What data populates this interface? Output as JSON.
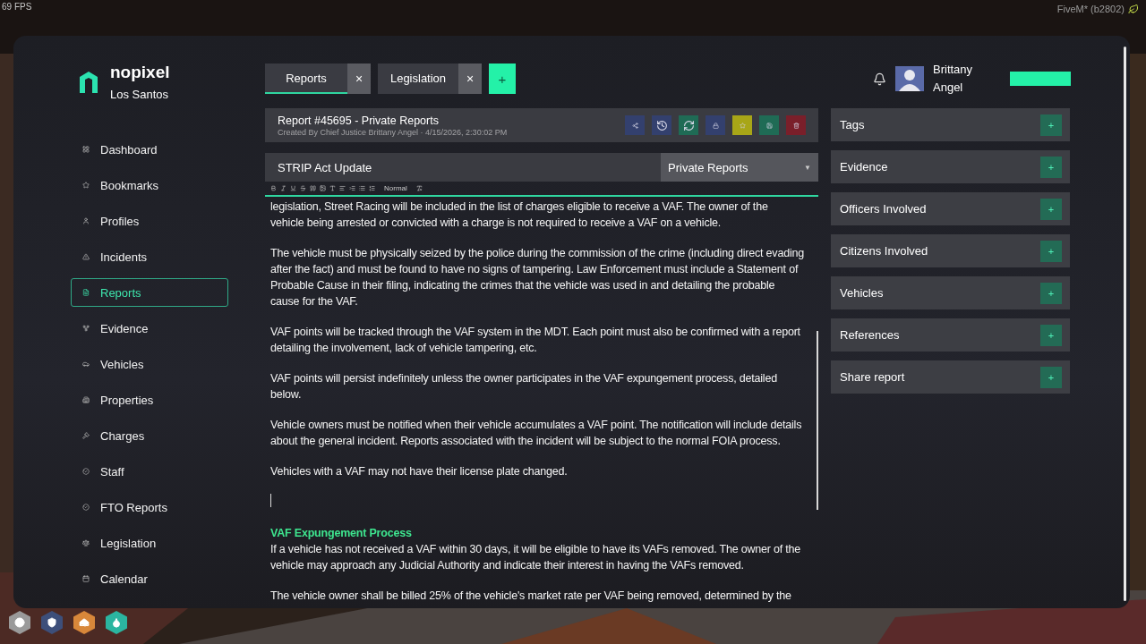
{
  "overlay": {
    "fps": "69 FPS",
    "build": "FiveM* (b2802)"
  },
  "brand": {
    "name": "nopixel",
    "city": "Los Santos"
  },
  "sidebar": {
    "items": [
      {
        "label": "Dashboard",
        "kind": "grid",
        "selected": false
      },
      {
        "label": "Bookmarks",
        "kind": "star",
        "selected": false
      },
      {
        "label": "Profiles",
        "kind": "user",
        "selected": false
      },
      {
        "label": "Incidents",
        "kind": "alert",
        "selected": false
      },
      {
        "label": "Reports",
        "kind": "file",
        "selected": true
      },
      {
        "label": "Evidence",
        "kind": "fork",
        "selected": false
      },
      {
        "label": "Vehicles",
        "kind": "car",
        "selected": false
      },
      {
        "label": "Properties",
        "kind": "building",
        "selected": false
      },
      {
        "label": "Charges",
        "kind": "gavel",
        "selected": false
      },
      {
        "label": "Staff",
        "kind": "badge",
        "selected": false
      },
      {
        "label": "FTO Reports",
        "kind": "badge",
        "selected": false
      },
      {
        "label": "Legislation",
        "kind": "scale",
        "selected": false
      },
      {
        "label": "Calendar",
        "kind": "calendar",
        "selected": false
      }
    ]
  },
  "tabs": [
    {
      "label": "Reports",
      "close": "×",
      "selected": true
    },
    {
      "label": "Legislation",
      "close": "×",
      "selected": false
    }
  ],
  "new_tab": "+",
  "user": {
    "name": "Brittany Angel"
  },
  "report": {
    "title": "Report #45695 - Private Reports",
    "subtitle": "Created By Chief Justice Brittany Angel · 4/15/2026, 2:30:02 PM",
    "actions": [
      {
        "kind": "share",
        "color": "#33406e"
      },
      {
        "kind": "history",
        "color": "#33406e"
      },
      {
        "kind": "refresh",
        "color": "#1f6b55"
      },
      {
        "kind": "lock",
        "color": "#33406e"
      },
      {
        "kind": "star",
        "color": "#a8a617"
      },
      {
        "kind": "save",
        "color": "#1f6b55"
      },
      {
        "kind": "delete",
        "color": "#7a1f2a"
      }
    ],
    "name": "STRIP Act Update",
    "category": "Private Reports",
    "caret": "▼"
  },
  "editor": {
    "heading_style": "Normal",
    "content": [
      {
        "kind": "paragraph",
        "text": "legislation, Street Racing will be included in the list of charges eligible to receive a VAF. The owner of the vehicle being arrested or convicted with a charge is not required to receive a VAF on a vehicle."
      },
      {
        "kind": "paragraph",
        "text": "The vehicle must be physically seized by the police during the commission of the crime (including direct evading after the fact) and must be found to have no signs of tampering. Law Enforcement must include a Statement of Probable Cause in their filing, indicating the crimes that the vehicle was used in and detailing the probable cause for the VAF."
      },
      {
        "kind": "paragraph",
        "text": "VAF points will be tracked through the VAF system in the MDT. Each point must also be confirmed with a report detailing the involvement, lack of vehicle tampering, etc."
      },
      {
        "kind": "paragraph",
        "text": "VAF points will persist indefinitely unless the owner participates in the VAF expungement process, detailed below."
      },
      {
        "kind": "paragraph",
        "text": "Vehicle owners must be notified when their vehicle accumulates a VAF point. The notification will include details about the general incident. Reports associated with the incident will be subject to the normal FOIA process."
      },
      {
        "kind": "paragraph",
        "text": "Vehicles with a VAF may not have their license plate changed."
      },
      {
        "kind": "cursor"
      },
      {
        "kind": "heading",
        "text": "VAF Expungement Process"
      },
      {
        "kind": "line",
        "text": "If a vehicle has not received a VAF within 30 days, it will be eligible to have its VAFs removed. The owner of the vehicle may approach any Judicial Authority and indicate their interest in having the VAFs removed."
      },
      {
        "kind": "paragraph",
        "text": "The vehicle owner shall be billed 25% of the vehicle's market rate per VAF being removed, determined by the"
      }
    ]
  },
  "sections": [
    {
      "label": "Tags",
      "add": "+"
    },
    {
      "label": "Evidence",
      "add": "+"
    },
    {
      "label": "Officers Involved",
      "add": "+"
    },
    {
      "label": "Citizens Involved",
      "add": "+"
    },
    {
      "label": "Vehicles",
      "add": "+"
    },
    {
      "label": "References",
      "add": "+"
    },
    {
      "label": "Share report",
      "add": "+"
    }
  ],
  "hud": [
    {
      "kind": "circle",
      "color": "#9a9a9a"
    },
    {
      "kind": "shield",
      "color": "#3d4f7a"
    },
    {
      "kind": "food",
      "color": "#d8873a"
    },
    {
      "kind": "drop",
      "color": "#2bb5a0"
    }
  ]
}
